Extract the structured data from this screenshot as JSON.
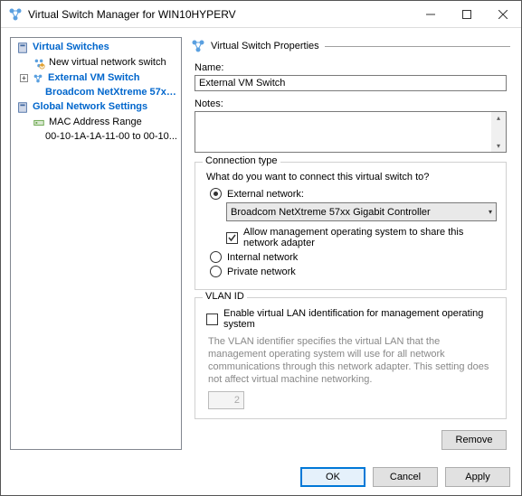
{
  "window": {
    "title": "Virtual Switch Manager for WIN10HYPERV"
  },
  "sidebar": {
    "section_virtual_switches": "Virtual Switches",
    "new_switch": "New virtual network switch",
    "external_switch": "External VM Switch",
    "external_switch_detail": "Broadcom NetXtreme 57xx Gi...",
    "section_global": "Global Network Settings",
    "mac_range": "MAC Address Range",
    "mac_range_detail": "00-10-1A-1A-11-00 to 00-10..."
  },
  "props": {
    "header": "Virtual Switch Properties",
    "name_label": "Name:",
    "name_value": "External VM Switch",
    "notes_label": "Notes:",
    "conn_group": "Connection type",
    "conn_prompt": "What do you want to connect this virtual switch to?",
    "opt_external": "External network:",
    "adapter": "Broadcom NetXtreme 57xx Gigabit Controller",
    "allow_mgmt": "Allow management operating system to share this network adapter",
    "opt_internal": "Internal network",
    "opt_private": "Private network",
    "vlan_group": "VLAN ID",
    "vlan_enable": "Enable virtual LAN identification for management operating system",
    "vlan_desc": "The VLAN identifier specifies the virtual LAN that the management operating system will use for all network communications through this network adapter. This setting does not affect virtual machine networking.",
    "vlan_value": "2",
    "remove": "Remove"
  },
  "footer": {
    "ok": "OK",
    "cancel": "Cancel",
    "apply": "Apply"
  }
}
